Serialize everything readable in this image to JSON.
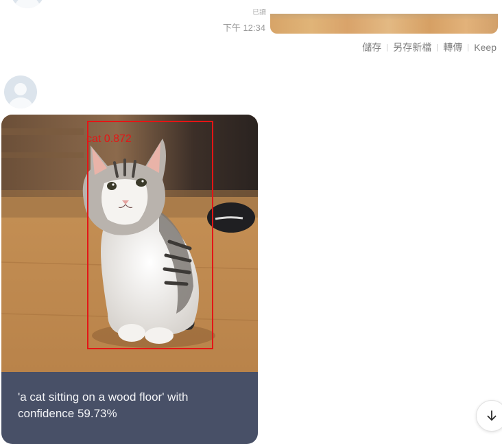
{
  "chat": {
    "sent": {
      "read_label": "已讀",
      "time": "下午 12:34",
      "image_desc": "cropped photo strip"
    },
    "actions": [
      {
        "label": "儲存"
      },
      {
        "label": "另存新檔"
      },
      {
        "label": "轉傳"
      },
      {
        "label": "Keep"
      }
    ],
    "received": {
      "detection_label": "cat 0.872",
      "caption": "'a cat sitting on a wood floor' with confidence 59.73%"
    }
  },
  "icons": {
    "scroll": "arrow-down-icon",
    "avatar": "default-user-avatar"
  }
}
